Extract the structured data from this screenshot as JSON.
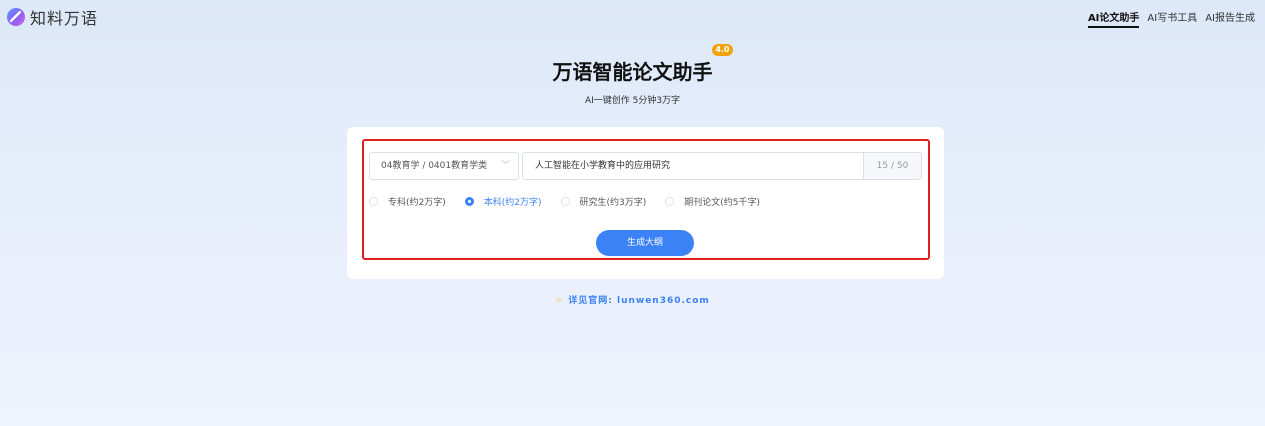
{
  "header": {
    "logo_text": "知料万语",
    "logo_icon": "logo-mark",
    "nav": [
      {
        "label": "AI论文助手",
        "active": true
      },
      {
        "label": "AI写书工具",
        "active": false
      },
      {
        "label": "AI报告生成",
        "active": false
      }
    ]
  },
  "hero": {
    "title": "万语智能论文助手",
    "version": "4.0",
    "subtitle": "AI一键创作 5分钟3万字"
  },
  "form": {
    "category_value": "04教育学 / 0401教育学类",
    "topic_value": "人工智能在小学教育中的应用研究",
    "counter": "15 / 50",
    "options": [
      {
        "label": "专科(约2万字)",
        "checked": false
      },
      {
        "label": "本科(约2万字)",
        "checked": true
      },
      {
        "label": "研究生(约3万字)",
        "checked": false
      },
      {
        "label": "期刊论文(约5千字)",
        "checked": false
      }
    ],
    "generate_label": "生成大纲"
  },
  "footer": {
    "link_text": "详见官网: lunwen360.com",
    "link_icon": "pointing-hand-icon"
  },
  "colors": {
    "accent": "#3b82f6",
    "highlight": "#e02020",
    "badge": "#f0a30a"
  }
}
